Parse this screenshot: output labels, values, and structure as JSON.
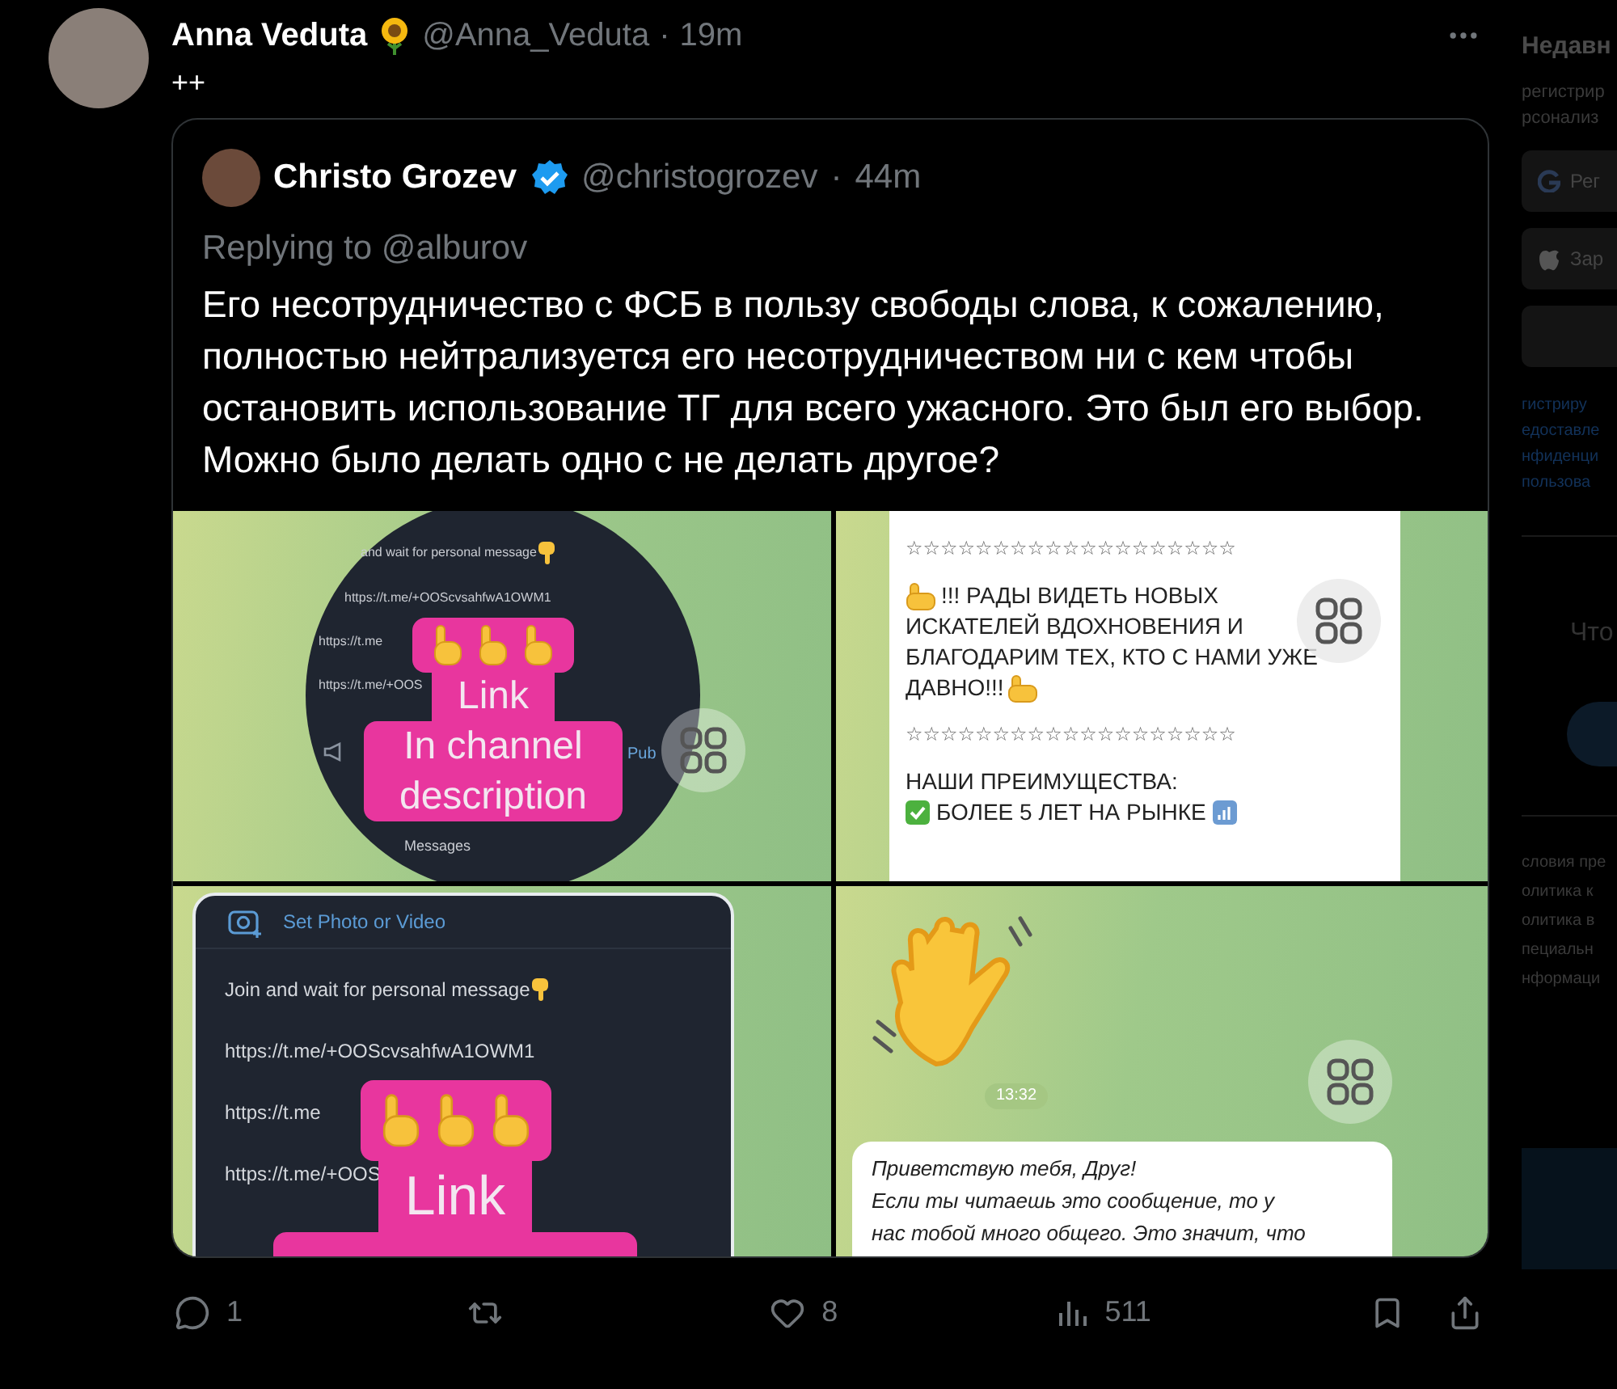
{
  "tweet": {
    "author": "Anna Veduta",
    "handle": "@Anna_Veduta",
    "separator": "·",
    "time": "19m",
    "text": "++",
    "quote": {
      "author": "Christo Grozev",
      "verified": true,
      "handle": "@christogrozev",
      "separator": "·",
      "time": "44m",
      "replying_to": "Replying to @alburov",
      "text": "Его несотрудничество с ФСБ в пользу свободы слова, к сожалению, полностью нейтрализуется его несотрудничеством ни с кем чтобы остановить использование ТГ для всего ужасного. Это был его выбор. Можно было делать одно с не делать другое?",
      "media": [
        {
          "kind": "link_circle",
          "lines": [
            "and wait for personal message",
            "https://t.me/+OOScvsahfwA1OWM1",
            "https://t.me",
            "https://t.me/+OOS"
          ],
          "side_label": "Pub",
          "footer": "Messages",
          "sticker_top": "Link",
          "sticker_bottom": "In channel description"
        },
        {
          "kind": "promo_message",
          "separators": [
            "☆☆☆☆☆☆☆☆☆☆☆☆☆☆☆☆☆☆☆",
            "☆☆☆☆☆☆☆☆☆☆☆☆☆☆☆☆☆☆☆"
          ],
          "greeting_lines": [
            "!!! РАДЫ ВИДЕТЬ НОВЫХ",
            "ИСКАТЕЛЕЙ ВДОХНОВЕНИЯ И",
            "БЛАГОДАРИМ ТЕХ, КТО С НАМИ УЖЕ",
            "ДАВНО!!!"
          ],
          "heading": "НАШИ ПРЕИМУЩЕСТВА:",
          "item": "БОЛЕЕ 5 ЛЕТ НА РЫНКЕ"
        },
        {
          "kind": "link_card",
          "action": "Set Photo or Video",
          "lines": [
            "Join and wait for personal message",
            "https://t.me/+OOScvsahfwA1OWM1",
            "https://t.me",
            "https://t.me/+OOS"
          ],
          "sticker_top": "Link"
        },
        {
          "kind": "greeting",
          "time": "13:32",
          "message_lines": [
            "Приветствую тебя, Друг!",
            "Если ты читаешь это сообщение, то у",
            "нас тобой много общего. Это значит, что"
          ]
        }
      ]
    },
    "actions": [
      {
        "kind": "reply",
        "count": "1"
      },
      {
        "kind": "retweet"
      },
      {
        "kind": "like",
        "count": "8"
      },
      {
        "kind": "views",
        "count": "511"
      },
      {
        "kind": "bookmark"
      },
      {
        "kind": "share"
      }
    ]
  },
  "sidebar": {
    "heading": "Недавн",
    "notes": [
      "регистрир",
      "рсонализ"
    ],
    "buttons": [
      {
        "kind": "google",
        "label": "Рег"
      },
      {
        "kind": "apple",
        "label": "Зар"
      },
      {
        "kind": "plain"
      }
    ],
    "legal": [
      "гистриру",
      "едоставле",
      "нфиденци",
      "пользова"
    ],
    "prompt": "Что",
    "links": [
      "словия пре",
      "олитика к",
      "олитика в",
      "пециальн",
      "нформаци"
    ]
  }
}
